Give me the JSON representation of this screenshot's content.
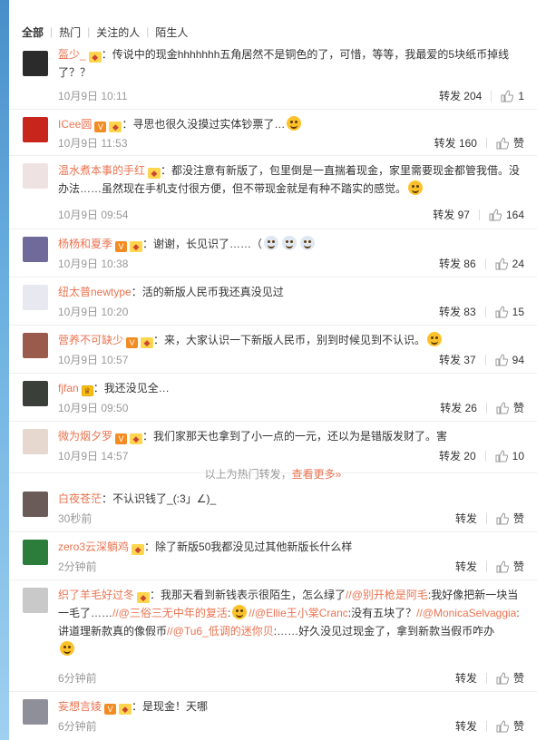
{
  "tabs": [
    "全部",
    "热门",
    "关注的人",
    "陌生人"
  ],
  "comments": [
    {
      "user": "盔少_",
      "text": "：传说中的现金hhhhhhh五角居然不是铜色的了，可惜，等等，我最爱的5块纸币掉线了？？",
      "time": "10月9日 10:11",
      "forward": "转发 204",
      "like": "1"
    },
    {
      "user": "ICee圆",
      "text": "：寻思也很久没摸过实体钞票了…",
      "time": "10月9日 11:53",
      "forward": "转发 160",
      "like": "赞"
    },
    {
      "user": "温水煮本事的手红",
      "text": "：都没注意有新版了，包里倒是一直揣着现金，家里需要现金都管我借。没办法……虽然现在手机支付很方便，但不带现金就是有种不踏实的感觉。",
      "time": "10月9日 09:54",
      "forward": "转发 97",
      "like": "164"
    },
    {
      "user": "杨杨和夏季",
      "text": "：谢谢，长见识了……（",
      "time": "10月9日 10:38",
      "forward": "转发 86",
      "like": "24"
    },
    {
      "user": "纽太普newtype",
      "text": "：活的新版人民币我还真没见过",
      "time": "10月9日 10:20",
      "forward": "转发 83",
      "like": "15"
    },
    {
      "user": "营养不可缺少",
      "text": "：来，大家认识一下新版人民币，别到时候见到不认识。",
      "time": "10月9日 10:57",
      "forward": "转发 37",
      "like": "94"
    },
    {
      "user": "fjfan",
      "text": "：我还没见全…",
      "time": "10月9日 09:50",
      "forward": "转发 26",
      "like": "赞"
    },
    {
      "user": "微为烟夕罗",
      "text": "：我们家那天也拿到了小一点的一元，还以为是错版发财了。害",
      "time": "10月9日 14:57",
      "forward": "转发 20",
      "like": "10"
    }
  ],
  "more": {
    "prefix": "以上为热门转发，",
    "link": "查看更多»"
  },
  "recent": [
    {
      "user": "白夜苍茫",
      "text": "：不认识钱了_(:3」∠)_",
      "time": "30秒前",
      "forward": "转发",
      "like": "赞"
    },
    {
      "user": "zero3云深躺鸡",
      "text": "：除了新版50我都没见过其他新版长什么样",
      "time": "2分钟前",
      "forward": "转发",
      "like": "赞"
    },
    {
      "user": "织了羊毛好过冬",
      "text_a": "：我那天看到新钱表示很陌生，怎么绿了",
      "m1": "//@别开枪是阿毛",
      "text_b": ":我好像把新一块当一毛了……",
      "m2": "//@三俗三无中年的复活",
      "text_c": ":",
      "m3": "//@Ellie王小棠Cranc",
      "text_d": ":没有五块了？",
      "m4": "//@MonicaSelvaggia",
      "text_e": ":讲道理新款真的像假币",
      "m5": "//@Tu6_低调的迷你贝",
      "text_f": ":……好久没见过现金了，拿到新款当假币咋办",
      "time": "6分钟前",
      "forward": "转发",
      "like": "赞"
    },
    {
      "user": "妄想言婈",
      "text": "：是现金！天哪",
      "time": "6分钟前",
      "forward": "转发",
      "like": "赞"
    }
  ]
}
